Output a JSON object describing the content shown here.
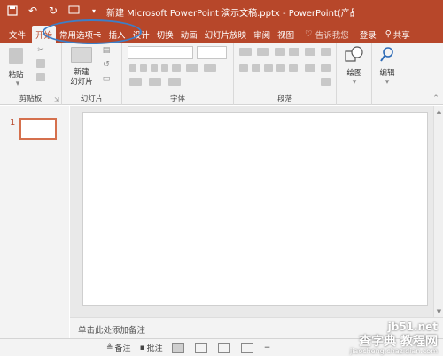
{
  "titlebar": {
    "title": "新建 Microsoft PowerPoint 演示文稿.pptx - PowerPoint(产品...",
    "qat_icons": [
      "save-icon",
      "undo-icon",
      "redo-icon",
      "start-from-beginning-icon"
    ]
  },
  "tabs": [
    {
      "label": "文件",
      "active": false
    },
    {
      "label": "开始",
      "active": true
    },
    {
      "label": "常用选项卡",
      "active": false
    },
    {
      "label": "插入",
      "active": false
    },
    {
      "label": "设计",
      "active": false
    },
    {
      "label": "切换",
      "active": false
    },
    {
      "label": "动画",
      "active": false
    },
    {
      "label": "幻灯片放映",
      "active": false
    },
    {
      "label": "审阅",
      "active": false
    },
    {
      "label": "视图",
      "active": false
    }
  ],
  "tell_me": "告诉我您",
  "login": "登录",
  "share": "共享",
  "ribbon": {
    "paste_label": "粘贴",
    "clipboard_label": "剪贴板",
    "new_slide_line1": "新建",
    "new_slide_line2": "幻灯片",
    "slides_label": "幻灯片",
    "font_label": "字体",
    "paragraph_label": "段落",
    "drawing_label": "绘图",
    "editing_label": "编辑"
  },
  "slide_pane": {
    "thumb_number": "1"
  },
  "notes_placeholder": "单击此处添加备注",
  "status": {
    "notes_label": "备注",
    "comments_label": "批注"
  },
  "watermark": {
    "line1": "jb51.net",
    "line2": "查字典 教程网",
    "line3": "jiaocheng.chazidian.com"
  },
  "colors": {
    "accent": "#b7472a",
    "highlight": "#3c7fc8"
  }
}
